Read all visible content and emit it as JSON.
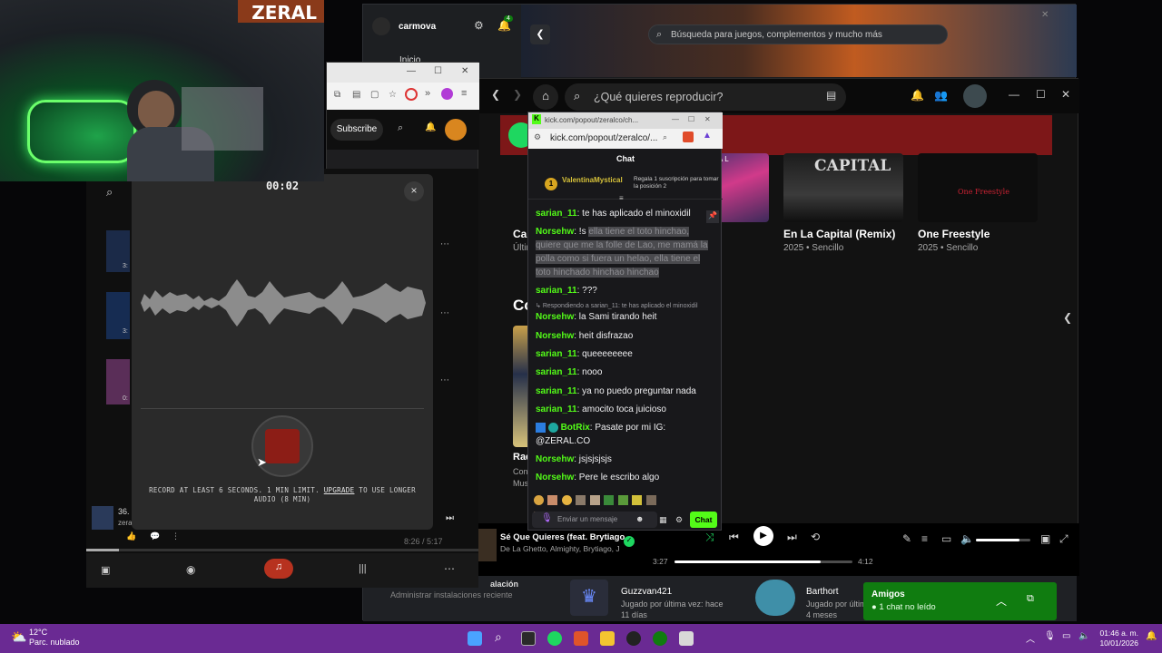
{
  "xbox": {
    "user": "carmova",
    "notif_count": "4",
    "search_placeholder": "Búsqueda para juegos, complementos y mucho más",
    "nav_home": "Inicio",
    "section_label": "alación",
    "install_manage": "Administrar instalaciones reciente",
    "friends": [
      {
        "name": "Guzzvan421",
        "status": "Jugado por última vez: hace",
        "time": "11 días"
      },
      {
        "name": "Barthort",
        "status": "Jugado por últim",
        "time": "4 meses"
      }
    ]
  },
  "spotify": {
    "search_placeholder": "¿Qué quieres reproducir?",
    "albums": [
      {
        "title": "Cap",
        "sub": "Últim"
      },
      {
        "title": "En La Capital (Remix)",
        "sub": "2025 • Sencillo"
      },
      {
        "title": "One Freestyle",
        "sub": "2025 • Sencillo"
      }
    ],
    "album_art_text": [
      "PITAL",
      "CAPITAL"
    ],
    "section_partial": "Co",
    "side_partial": [
      "Rac",
      "Con",
      "Mus"
    ],
    "now_playing": {
      "title": "Sé Que Quieres (feat. Brytiago",
      "artists": "De La Ghetto, Almighty, Brytiago, J",
      "elapsed": "3:27",
      "total": "4:12",
      "progress": 0.82
    }
  },
  "kick": {
    "url_bar": "kick.com/popout/zeralco/ch...",
    "address": "kick.com/popout/zeralco/...",
    "chat_title": "Chat",
    "pinned_user": "ValentinaMystical",
    "pinned_badge": "1",
    "pinned_note": "Regala 1 suscripción para tomar la posición 2",
    "messages": [
      {
        "user": "sarian_11",
        "text": "te has aplicado el minoxidil"
      },
      {
        "user": "Norsehw",
        "text": "!s",
        "hidden": "ella tiene el toto hinchao, quiere que me la folle de Lao, me mamá la polla como si fuera un helao, ella tiene el toto hinchado hinchao hinchao"
      },
      {
        "user": "sarian_11",
        "text": "???"
      },
      {
        "reply": "Respondiendo a sarian_11: te has aplicado el minoxidil",
        "user": "Norsehw",
        "text": "la Sami tirando heit"
      },
      {
        "user": "Norsehw",
        "text": "heit disfrazao"
      },
      {
        "user": "sarian_11",
        "text": "queeeeeeee"
      },
      {
        "user": "sarian_11",
        "text": "nooo"
      },
      {
        "user": "sarian_11",
        "text": "ya no puedo preguntar nada"
      },
      {
        "user": "sarian_11",
        "text": "amocito toca juicioso"
      },
      {
        "user": "BotRix",
        "text": "Pasate por mi IG: @ZERAL.CO"
      },
      {
        "user": "Norsehw",
        "text": "jsjsjsjsjs"
      },
      {
        "user": "Norsehw",
        "text": "Pere le escribo algo"
      }
    ],
    "input_placeholder": "Enviar un mensaje",
    "send_label": "Chat"
  },
  "browser": {
    "subscribe": "Subscribe"
  },
  "youtube": {
    "time": "8:26 / 5:17",
    "count_partial": "36.",
    "sub_partial": "zera",
    "row_labels": [
      "3:",
      "3:",
      "0:"
    ]
  },
  "recorder": {
    "timer": "00:02",
    "close": "×",
    "note_pre": "RECORD AT LEAST 6 SECONDS. 1 MIN LIMIT.",
    "note_link": "UPGRADE",
    "note_post": "TO USE LONGER AUDIO (8 MIN)"
  },
  "webcam": {
    "brand": "ZERAL"
  },
  "amigos": {
    "title": "Amigos",
    "sub": "1 chat no leído"
  },
  "taskbar": {
    "temp": "12°C",
    "weather": "Parc. nublado",
    "time": "01:46 a. m.",
    "date": "10/01/2026"
  },
  "colors": {
    "kick_green": "#53fc18",
    "spotify_red": "#7d1718",
    "taskbar": "#6a2a93",
    "xbox_green": "#107c10"
  }
}
